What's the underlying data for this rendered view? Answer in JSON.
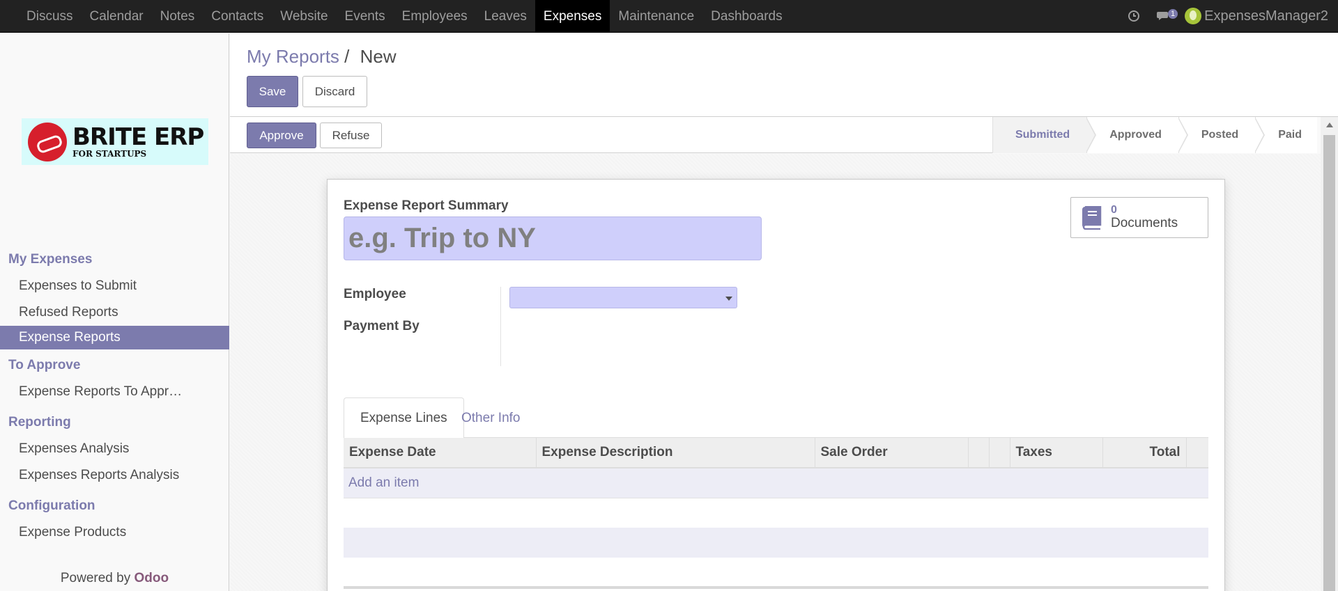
{
  "nav": {
    "apps": [
      "Discuss",
      "Calendar",
      "Notes",
      "Contacts",
      "Website",
      "Events",
      "Employees",
      "Leaves",
      "Expenses",
      "Maintenance",
      "Dashboards"
    ],
    "active_app": "Expenses",
    "chat_badge": "1",
    "user_name": "ExpensesManager2"
  },
  "sidebar": {
    "logo": {
      "title": "BRITE ERP",
      "tagline": "FOR STARTUPS"
    },
    "sections": [
      {
        "title": "My Expenses",
        "items": [
          "Expenses to Submit",
          "Refused Reports",
          "Expense Reports"
        ]
      },
      {
        "title": "To Approve",
        "items": [
          "Expense Reports To Appr…"
        ]
      },
      {
        "title": "Reporting",
        "items": [
          "Expenses Analysis",
          "Expenses Reports Analysis"
        ]
      },
      {
        "title": "Configuration",
        "items": [
          "Expense Products"
        ]
      }
    ],
    "active_item": "Expense Reports",
    "powered_prefix": "Powered by",
    "powered_brand": "Odoo"
  },
  "control_panel": {
    "breadcrumb_link": "My Reports",
    "breadcrumb_sep": "/",
    "breadcrumb_current": "New",
    "save_label": "Save",
    "discard_label": "Discard"
  },
  "status_bar": {
    "approve_label": "Approve",
    "refuse_label": "Refuse",
    "stages": [
      "Submitted",
      "Approved",
      "Posted",
      "Paid"
    ],
    "current_stage": "Submitted"
  },
  "form": {
    "summary_label": "Expense Report Summary",
    "summary_placeholder": "e.g. Trip to NY",
    "summary_value": "",
    "documents_count": "0",
    "documents_label": "Documents",
    "employee_label": "Employee",
    "payment_by_label": "Payment By",
    "employee_value": "",
    "tabs": [
      "Expense Lines",
      "Other Info"
    ],
    "active_tab": "Expense Lines",
    "columns": [
      "Expense Date",
      "Expense Description",
      "Sale Order",
      "",
      "",
      "Taxes",
      "Total"
    ],
    "add_item_label": "Add an item"
  },
  "colors": {
    "accent": "#7c7bad",
    "navbar": "#222222",
    "input_bg": "#cfcffb",
    "brand_odoo": "#875a7b"
  }
}
